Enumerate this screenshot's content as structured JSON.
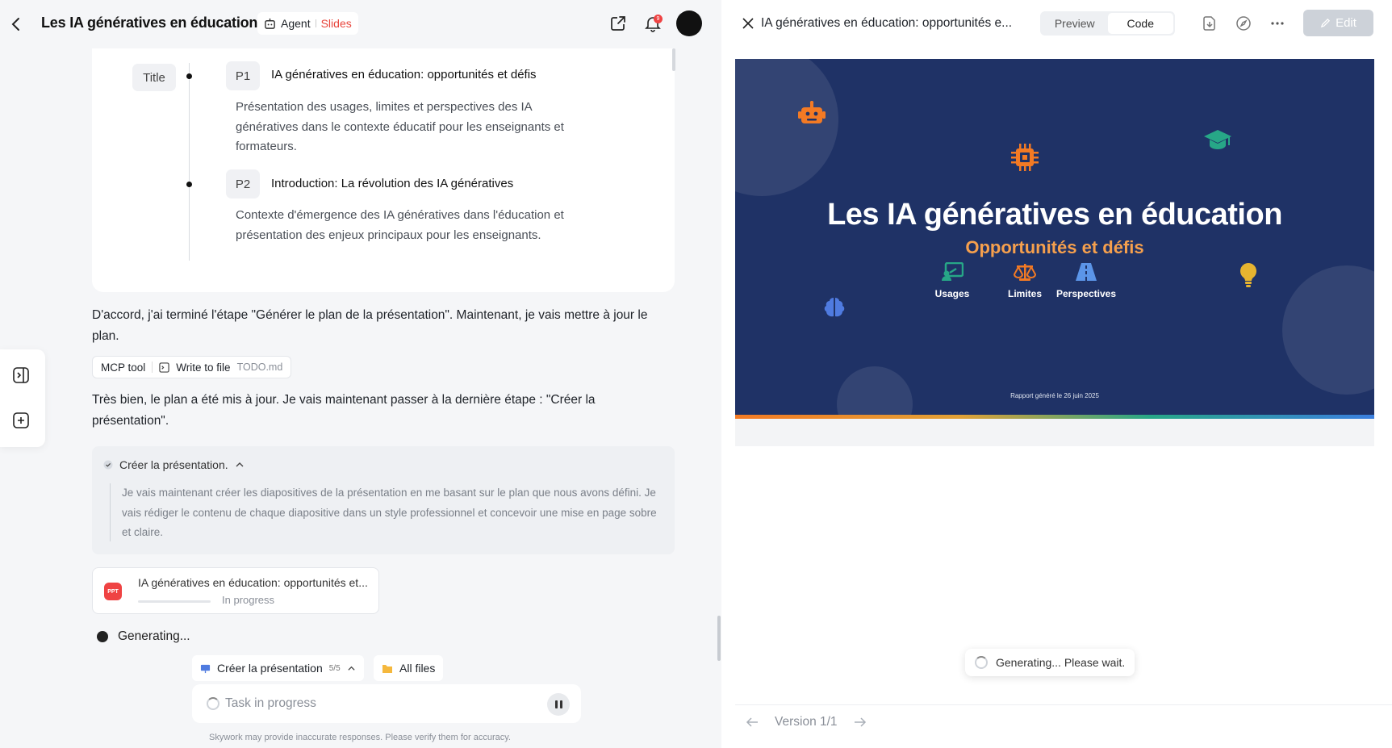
{
  "header": {
    "chat_title": "Les IA génératives en éducation",
    "mode_agent": "Agent",
    "mode_slides": "Slides",
    "notif_count": "9"
  },
  "outline": {
    "title_tag": "Title",
    "items": [
      {
        "tag": "P1",
        "title": "IA génératives en éducation: opportunités et défis",
        "desc": "Présentation des usages, limites et perspectives des IA génératives dans le contexte éducatif pour les enseignants et formateurs."
      },
      {
        "tag": "P2",
        "title": "Introduction: La révolution des IA génératives",
        "desc": "Contexte d'émergence des IA génératives dans l'éducation et présentation des enjeux principaux pour les enseignants."
      }
    ]
  },
  "chat": {
    "msg1": "D'accord, j'ai terminé l'étape \"Générer le plan de la présentation\". Maintenant, je vais mettre à jour le plan.",
    "tool_label": "MCP tool",
    "tool_action": "Write to file",
    "tool_file": "TODO.md",
    "msg2": "Très bien, le plan a été mis à jour. Je vais maintenant passer à la dernière étape : \"Créer la présentation\".",
    "think_title": "Créer la présentation.",
    "think_body": "Je vais maintenant créer les diapositives de la présentation en me basant sur le plan que nous avons défini. Je vais rédiger le contenu de chaque diapositive dans un style professionnel et concevoir une mise en page sobre et claire.",
    "file_badge": "PPT",
    "file_name": "IA génératives en éducation: opportunités et...",
    "file_status": "In progress",
    "generating": "Generating..."
  },
  "composer": {
    "task_chip": "Créer la présentation",
    "task_count": "5/5",
    "files_chip": "All files",
    "placeholder": "Task in progress",
    "disclaimer": "Skywork may provide inaccurate responses. Please verify them for accuracy."
  },
  "preview": {
    "doc_title": "IA génératives en éducation: opportunités e...",
    "tab_preview": "Preview",
    "tab_code": "Code",
    "edit_label": "Edit",
    "toast": "Generating... Please wait.",
    "version": "Version 1/1"
  },
  "slide": {
    "title": "Les IA génératives en éducation",
    "subtitle": "Opportunités et défis",
    "features": [
      "Usages",
      "Limites",
      "Perspectives"
    ],
    "date": "Rapport généré le 26 juin 2025",
    "colors": {
      "bg": "#1f3266",
      "accent": "#f6a04d",
      "teal": "#27a787",
      "blue": "#5b95e8"
    }
  }
}
